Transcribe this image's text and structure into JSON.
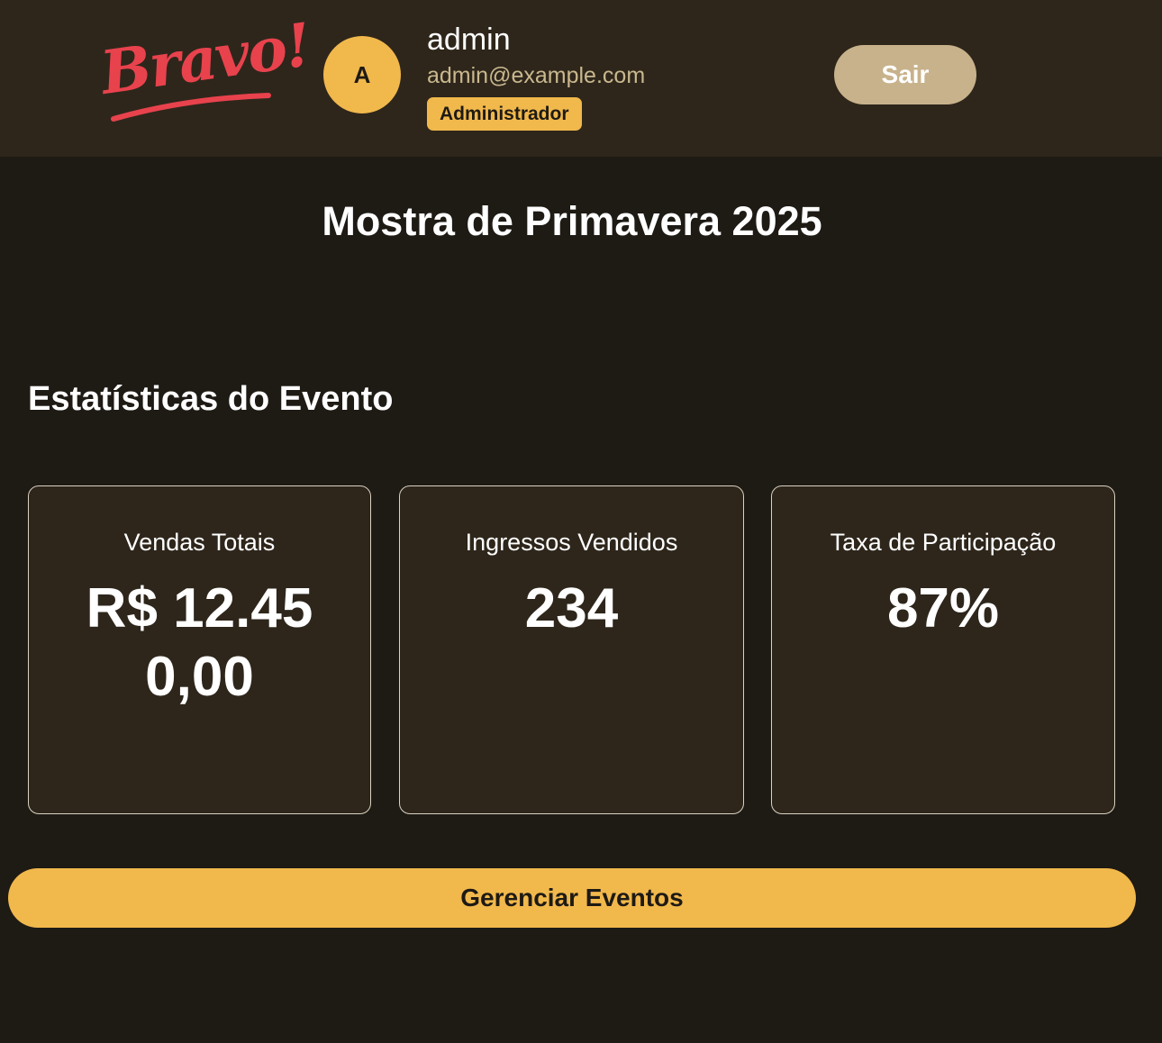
{
  "header": {
    "logo_text": "Bravo!",
    "avatar_initial": "A",
    "user_name": "admin",
    "user_email": "admin@example.com",
    "role_badge": "Administrador",
    "logout_label": "Sair"
  },
  "main": {
    "event_title": "Mostra de Primavera 2025",
    "section_title": "Estatísticas do Evento",
    "stats": [
      {
        "label": "Vendas Totais",
        "value": "R$ 12.450,00"
      },
      {
        "label": "Ingressos Vendidos",
        "value": "234"
      },
      {
        "label": "Taxa de Participação",
        "value": "87%"
      }
    ],
    "manage_button_label": "Gerenciar Eventos"
  },
  "colors": {
    "background": "#1e1a14",
    "header_bg": "#2e261b",
    "accent_yellow": "#f1b84c",
    "logo_red": "#e8424d",
    "logout_bg": "#c8b28b",
    "email_text": "#c9b88e"
  }
}
